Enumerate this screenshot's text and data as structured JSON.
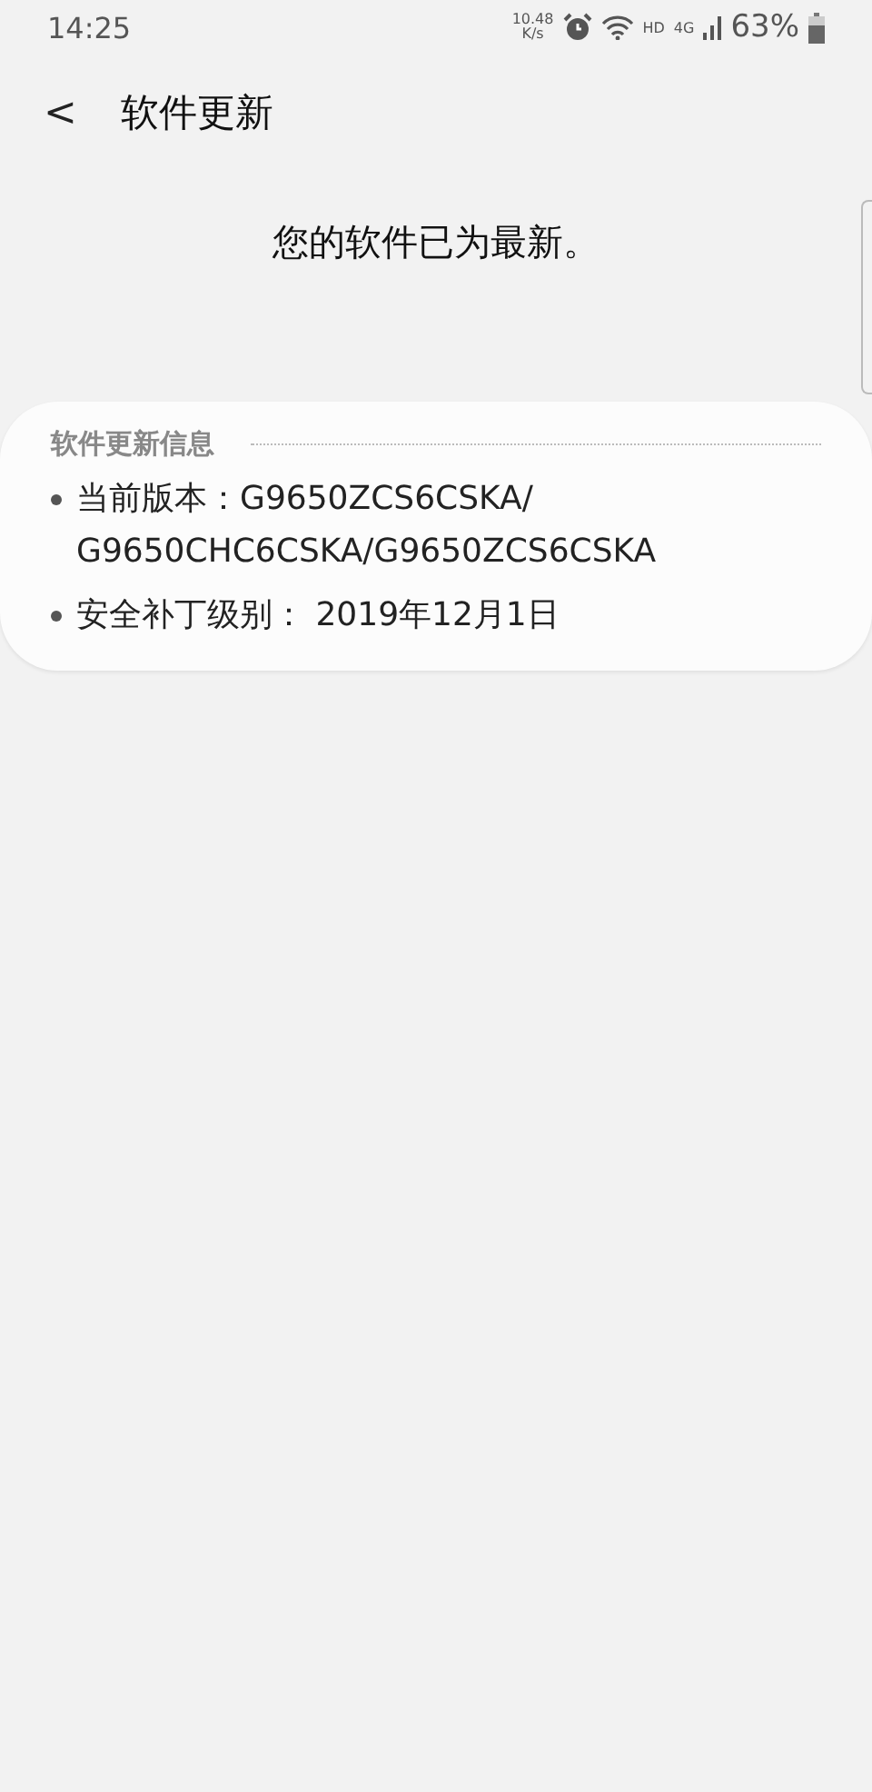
{
  "status_bar": {
    "time": "14:25",
    "net_speed": "10.48",
    "net_unit": "K/s",
    "hd": "HD",
    "network": "4G",
    "battery": "63%"
  },
  "header": {
    "back": "<",
    "title": "软件更新"
  },
  "message": "您的软件已为最新。",
  "info_card": {
    "title": "软件更新信息",
    "items": [
      {
        "lines": [
          "当前版本：G9650ZCS6CSKA/",
          "G9650CHC6CSKA/G9650ZCS6CSKA"
        ]
      },
      {
        "lines": [
          "安全补丁级别： 2019年12月1日"
        ]
      }
    ]
  }
}
